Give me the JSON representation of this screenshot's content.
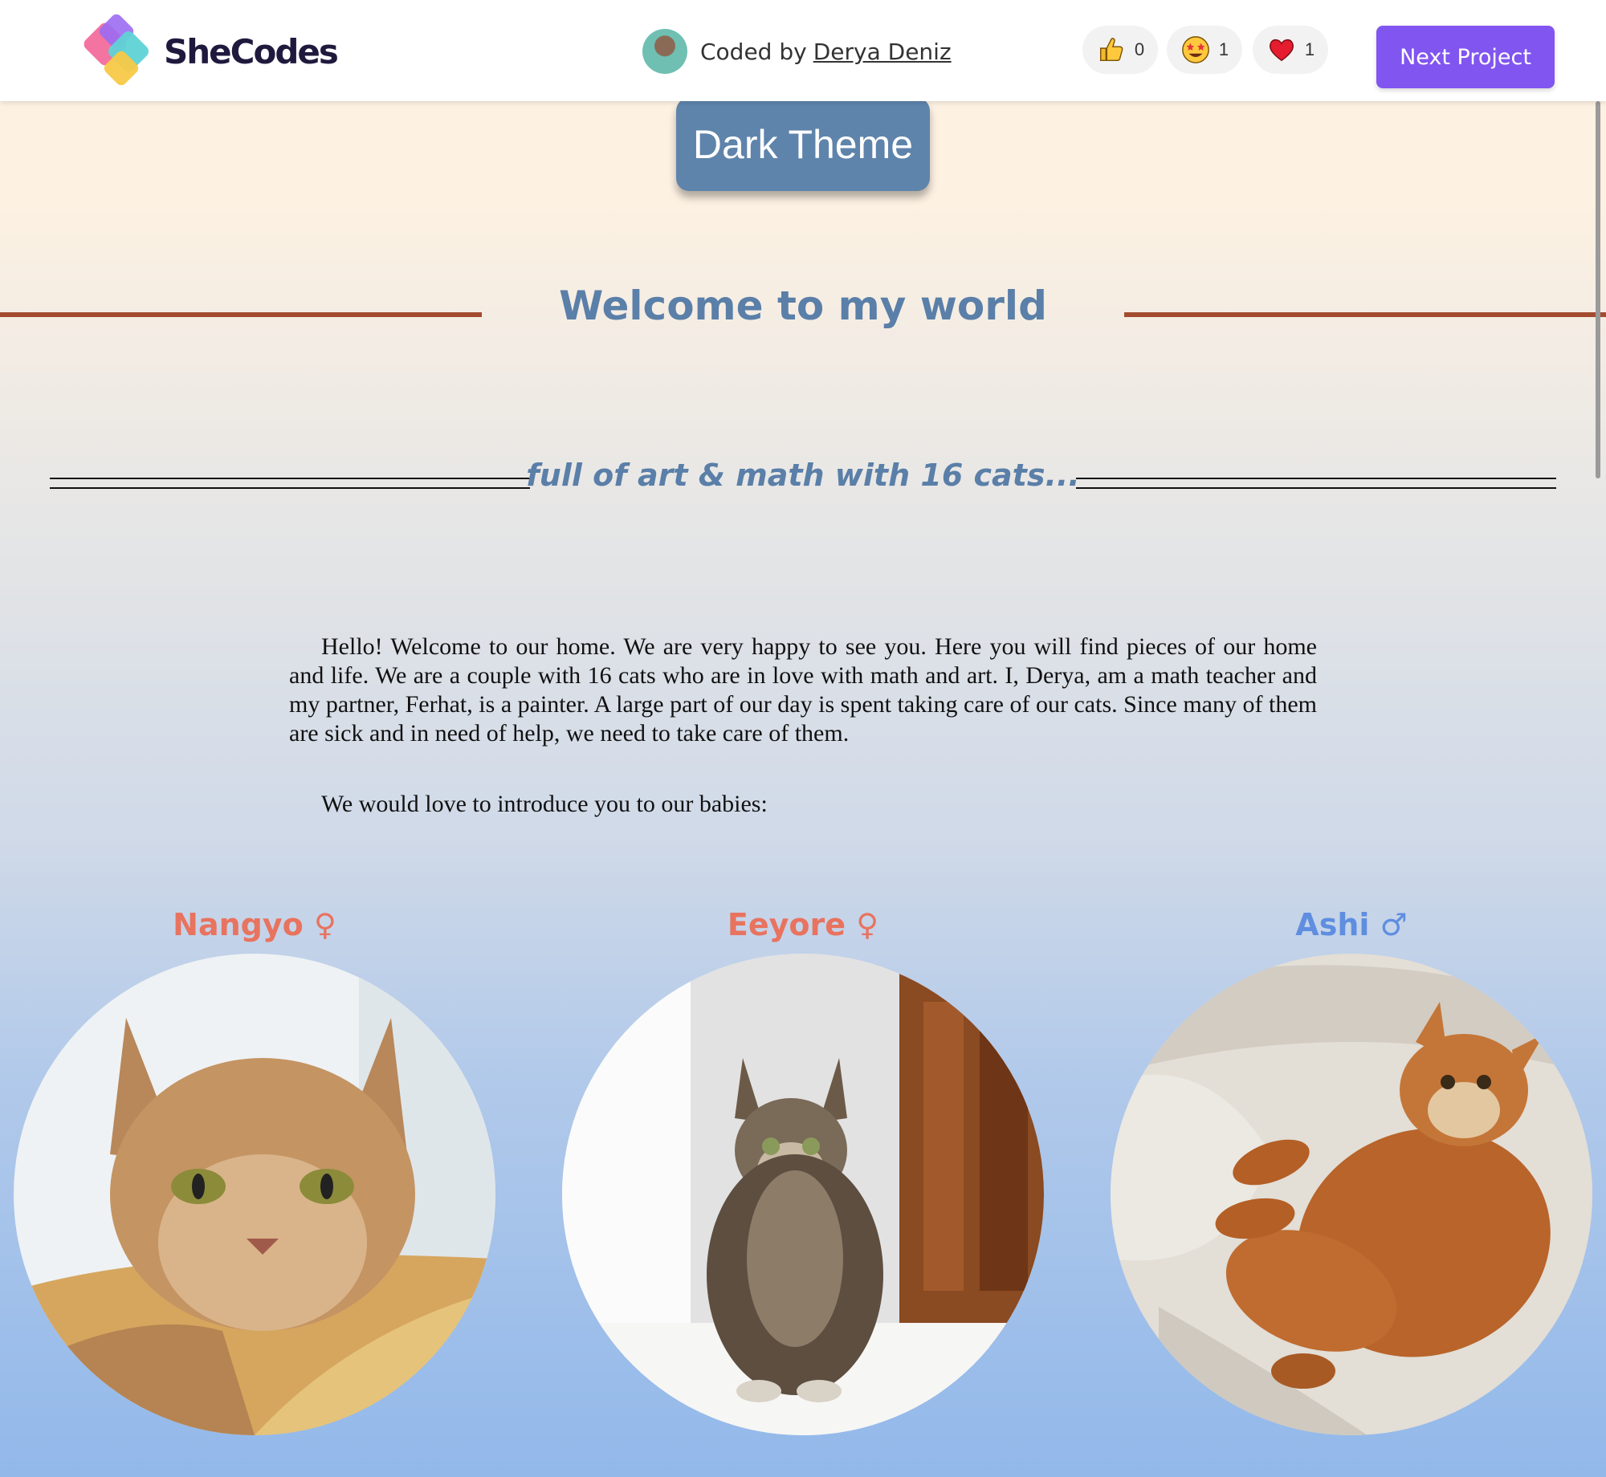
{
  "header": {
    "brand": "SheCodes",
    "coded_by_label": "Coded by",
    "author_name": "Derya Deniz",
    "reactions": [
      {
        "icon": "thumbs-up-icon",
        "count": "0"
      },
      {
        "icon": "star-struck-icon",
        "count": "1"
      },
      {
        "icon": "heart-icon",
        "count": "1"
      }
    ],
    "next_button": "Next Project"
  },
  "theme_button": "Dark Theme",
  "title": "Welcome to my world",
  "subtitle": "full of art & math with 16 cats...",
  "intro_paragraph": "Hello! Welcome to our home. We are very happy to see you. Here you will find pieces of our home and life. We are a couple with 16 cats who are in love with math and art. I, Derya, am a math teacher and my partner, Ferhat, is a painter. A large part of our day is spent taking care of our cats. Since many of them are sick and in need of help, we need to take care of them.",
  "intro_line": "We would love to introduce you to our babies:",
  "cats": [
    {
      "name": "Nangyo ♀",
      "color": "#e8735f"
    },
    {
      "name": "Eeyore ♀",
      "color": "#e8735f"
    },
    {
      "name": "Ashi ♂",
      "color": "#5f8ee0"
    }
  ],
  "colors": {
    "accent_purple": "#8155f0",
    "heading_blue": "#5a7fa8",
    "theme_button": "#5f84ab",
    "rule_brown": "#a34c30"
  }
}
